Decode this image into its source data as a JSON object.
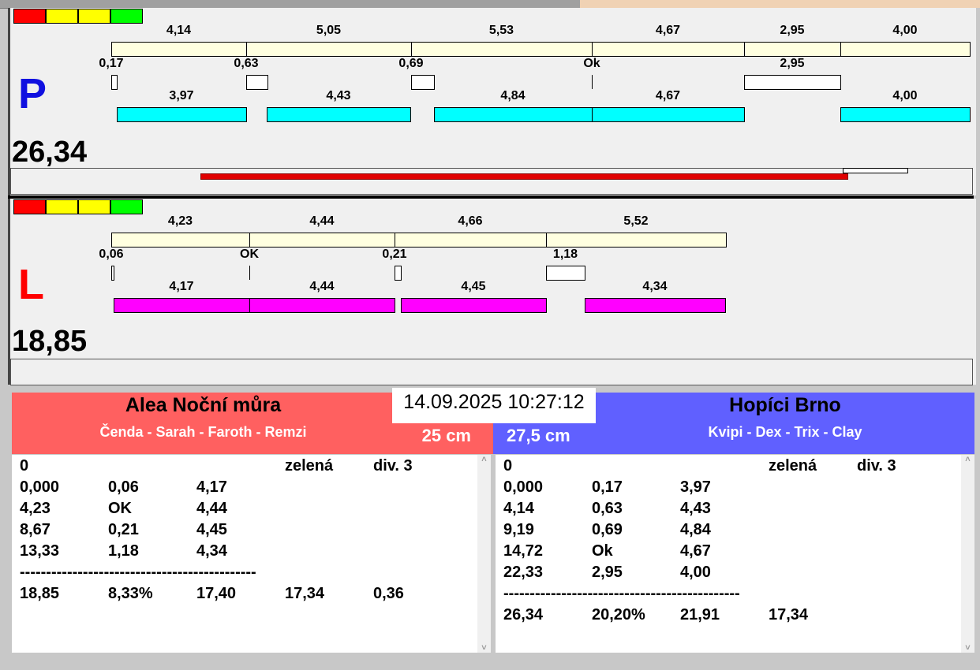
{
  "tabs_strip": {
    "accent": "#f0d2b4"
  },
  "scale_colors": [
    "#ff0000",
    "#ffff00",
    "#ffff00",
    "#00ff00"
  ],
  "P": {
    "letter": "P",
    "color": "#1010e0",
    "total": "26,34",
    "row1": [
      "4,14",
      "5,05",
      "5,53",
      "4,67",
      "2,95",
      "4,00"
    ],
    "row2": [
      "0,17",
      "0,63",
      "0,69",
      "Ok",
      "2,95"
    ],
    "row3": [
      "3,97",
      "4,43",
      "4,84",
      "4,67",
      "4,00"
    ],
    "row3_color": "#00ffff"
  },
  "L": {
    "letter": "L",
    "color": "#ff0000",
    "total": "18,85",
    "row1": [
      "4,23",
      "4,44",
      "4,66",
      "5,52"
    ],
    "row2": [
      "0,06",
      "OK",
      "0,21",
      "1,18"
    ],
    "row3": [
      "4,17",
      "4,44",
      "4,45",
      "4,34"
    ],
    "row3_color": "#ff00ff"
  },
  "datetime": "14.09.2025 10:27:12",
  "left_team": {
    "name": "Alea Noční můra",
    "members": "Čenda - Sarah - Faroth - Remzi",
    "height": "25 cm",
    "color": "#ff6060",
    "rows": [
      [
        "0",
        "",
        "",
        "zelená",
        "div. 3"
      ],
      [
        "0,000",
        "0,06",
        "4,17"
      ],
      [
        "4,23",
        "OK",
        "4,44"
      ],
      [
        "8,67",
        "0,21",
        "4,45"
      ],
      [
        "13,33",
        "1,18",
        "4,34"
      ],
      [
        "---------------------------------------------"
      ],
      [
        "18,85",
        "8,33%",
        "17,40",
        "17,34",
        "0,36"
      ]
    ]
  },
  "right_team": {
    "name": "Hopíci Brno",
    "members": "Kvipi - Dex - Trix - Clay",
    "height": "27,5 cm",
    "color": "#6060ff",
    "rows": [
      [
        "0",
        "",
        "",
        "zelená",
        "div. 3"
      ],
      [
        "0,000",
        "0,17",
        "3,97"
      ],
      [
        "4,14",
        "0,63",
        "4,43"
      ],
      [
        "9,19",
        "0,69",
        "4,84"
      ],
      [
        "14,72",
        "Ok",
        "4,67"
      ],
      [
        "22,33",
        "2,95",
        "4,00"
      ],
      [
        "---------------------------------------------"
      ],
      [
        "26,34",
        "20,20%",
        "21,91",
        "17,34"
      ]
    ]
  }
}
